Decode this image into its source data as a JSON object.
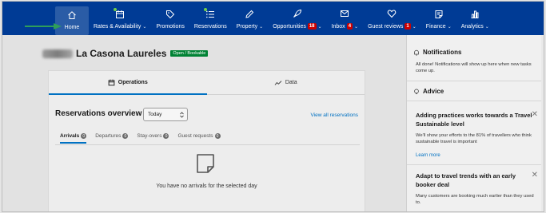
{
  "nav": {
    "items": [
      {
        "label": "Home",
        "icon": "home-icon",
        "active": true
      },
      {
        "label": "Rates & Availability",
        "icon": "calendar-icon",
        "chevron": true,
        "dot": true
      },
      {
        "label": "Promotions",
        "icon": "tag-icon"
      },
      {
        "label": "Reservations",
        "icon": "list-icon",
        "dot": true
      },
      {
        "label": "Property",
        "icon": "pencil-icon",
        "chevron": true
      },
      {
        "label": "Opportunities",
        "icon": "rocket-icon",
        "badge": "18",
        "chevron": true
      },
      {
        "label": "Inbox",
        "icon": "mail-icon",
        "badge": "4",
        "chevron": true
      },
      {
        "label": "Guest reviews",
        "icon": "heart-icon",
        "badge": "1",
        "chevron": true
      },
      {
        "label": "Finance",
        "icon": "document-icon",
        "chevron": true
      },
      {
        "label": "Analytics",
        "icon": "bar-chart-icon",
        "chevron": true
      }
    ],
    "chevron_glyph": "⌄"
  },
  "hotel": {
    "name": "La Casona Laureles",
    "status": "Open / Bookable"
  },
  "card": {
    "tabs": [
      {
        "label": "Operations",
        "icon": "calendar-icon",
        "selected": true
      },
      {
        "label": "Data",
        "icon": "trend-icon",
        "selected": false
      }
    ],
    "reservations_title": "Reservations overview",
    "period_select": "Today",
    "view_all": "View all reservations",
    "subtabs": [
      {
        "label": "Arrivals",
        "count": "0",
        "selected": true
      },
      {
        "label": "Departures",
        "count": "0",
        "selected": false
      },
      {
        "label": "Stay-overs",
        "count": "0",
        "selected": false
      },
      {
        "label": "Guest requests",
        "count": "0",
        "selected": false
      }
    ],
    "empty_text": "You have no arrivals for the selected day"
  },
  "sidebar": {
    "notifications_title": "Notifications",
    "notifications_text": "All done! Notifications will show up here when new tasks come up.",
    "advice_title": "Advice",
    "advice_items": [
      {
        "title": "Adding practices works towards a Travel Sustainable level",
        "text": "We'll show your efforts to the 81% of travellers who think sustainable travel is important",
        "link": "Learn more"
      },
      {
        "title": "Adapt to travel trends with an early booker deal",
        "text": "Many customers are booking much earlier than they used to."
      }
    ],
    "close_glyph": "✕"
  },
  "colors": {
    "nav_bg": "#003b95",
    "accent": "#0071c2",
    "open_badge": "#008234",
    "nav_badge": "#cc0000",
    "arrow": "#2e9e5a"
  }
}
